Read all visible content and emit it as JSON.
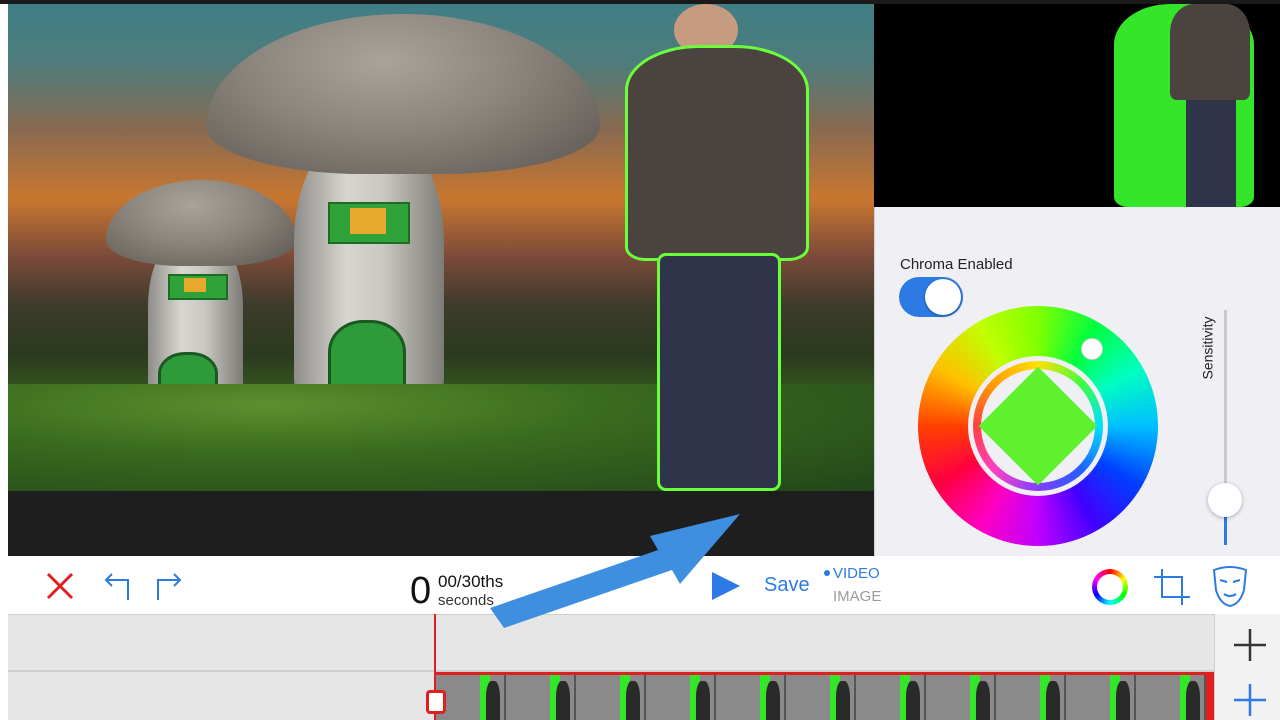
{
  "panel": {
    "chroma_label": "Chroma Enabled",
    "chroma_enabled": true,
    "sensitivity_label": "Sensitivity",
    "key_color": "#5ff02e"
  },
  "toolbar": {
    "time_seconds": "0",
    "time_fraction": "00/30ths",
    "time_unit": "seconds",
    "save_label": "Save",
    "mode_video": "VIDEO",
    "mode_image": "IMAGE",
    "mode_selected": "VIDEO"
  },
  "icons": [
    "close-icon",
    "undo-icon",
    "redo-icon",
    "play-icon",
    "color-wheel-icon",
    "crop-icon",
    "mask-icon",
    "add-icon"
  ],
  "colors": {
    "accent": "#2c7be5",
    "playhead": "#e02020",
    "chroma_green": "#35e52a",
    "close_red": "#e02020"
  }
}
